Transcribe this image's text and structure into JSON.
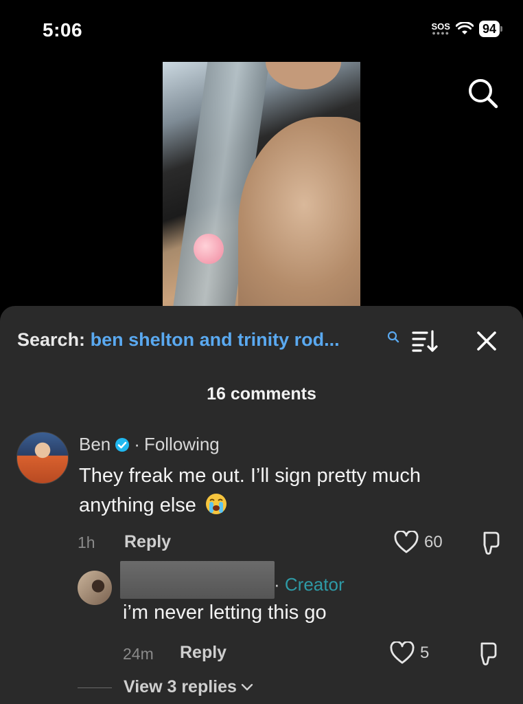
{
  "status_bar": {
    "time": "5:06",
    "sos": "SOS",
    "battery": "94"
  },
  "sheet": {
    "search_label": "Search:",
    "search_query": "ben shelton and trinity rod...",
    "comment_count": "16 comments"
  },
  "comments": [
    {
      "author": "Ben",
      "verified": true,
      "relation": "Following",
      "text": "They freak me out. I’ll sign pretty much anything else",
      "emoji": "loudly-crying-face",
      "time": "1h",
      "reply_label": "Reply",
      "likes": "60",
      "replies": [
        {
          "role": "Creator",
          "text": "i’m never letting this go",
          "time": "24m",
          "reply_label": "Reply",
          "likes": "5"
        }
      ],
      "view_replies": "View 3 replies"
    }
  ],
  "icons": {
    "top_search": "search-icon",
    "sort": "sort-icon",
    "close": "close-icon",
    "like": "heart-outline-icon",
    "dislike": "thumbs-down-icon"
  },
  "colors": {
    "accent_link": "#5aa9f0",
    "creator_tag": "#2e9aa6",
    "verified": "#20b8f0",
    "sheet_bg": "#2a2a2a"
  }
}
